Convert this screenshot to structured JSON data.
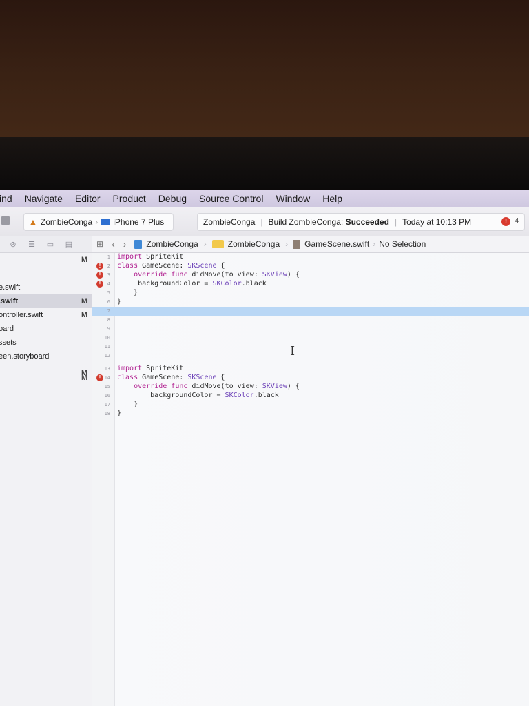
{
  "menu_bar": {
    "items": [
      "ind",
      "Navigate",
      "Editor",
      "Product",
      "Debug",
      "Source Control",
      "Window",
      "Help"
    ]
  },
  "toolbar": {
    "scheme": "ZombieConga",
    "device": "iPhone 7 Plus",
    "activity": {
      "project": "ZombieConga",
      "status_prefix": "Build ZombieConga: ",
      "status_result": "Succeeded",
      "time": "Today at 10:13 PM",
      "issue_count": "4",
      "issue_badge": "!"
    }
  },
  "jump_bar": {
    "items": [
      "ZombieConga",
      "ZombieConga",
      "GameScene.swift",
      "No Selection"
    ]
  },
  "navigator": {
    "files": [
      {
        "name": "",
        "mark": "M"
      },
      {
        "name": "e.swift",
        "mark": ""
      },
      {
        "name": ".swift",
        "mark": "M",
        "selected": true
      },
      {
        "name": "ontroller.swift",
        "mark": "M"
      },
      {
        "name": "oard",
        "mark": ""
      },
      {
        "name": "ssets",
        "mark": ""
      },
      {
        "name": "een.storyboard",
        "mark": ""
      },
      {
        "name": "",
        "mark": "M"
      }
    ]
  },
  "editor": {
    "lines": [
      {
        "n": "1",
        "code": "import SpriteKit",
        "error": false
      },
      {
        "n": "2",
        "code": "class GameScene: SKScene {",
        "error": true
      },
      {
        "n": "3",
        "code": "    override func didMove(to view: SKView) {",
        "error": true
      },
      {
        "n": "4",
        "code": "     backgroundColor = SKColor.black",
        "error": true
      },
      {
        "n": "5",
        "code": "    }",
        "error": false
      },
      {
        "n": "6",
        "code": "}",
        "error": false
      },
      {
        "n": "7",
        "code": "",
        "error": false,
        "highlight": true
      },
      {
        "n": "8",
        "code": "",
        "error": false
      },
      {
        "n": "9",
        "code": "",
        "error": false
      },
      {
        "n": "10",
        "code": "",
        "error": false
      },
      {
        "n": "11",
        "code": "",
        "error": false
      },
      {
        "n": "12",
        "code": "",
        "error": false
      },
      {
        "n": "13",
        "code": "import SpriteKit",
        "error": false
      },
      {
        "n": "14",
        "code": "class GameScene: SKScene {",
        "error": true,
        "scm": "M"
      },
      {
        "n": "15",
        "code": "    override func didMove(to view: SKView) {",
        "error": false
      },
      {
        "n": "16",
        "code": "        backgroundColor = SKColor.black",
        "error": false
      },
      {
        "n": "17",
        "code": "    }",
        "error": false
      },
      {
        "n": "18",
        "code": "}",
        "error": false
      }
    ],
    "error_glyph": "!"
  }
}
